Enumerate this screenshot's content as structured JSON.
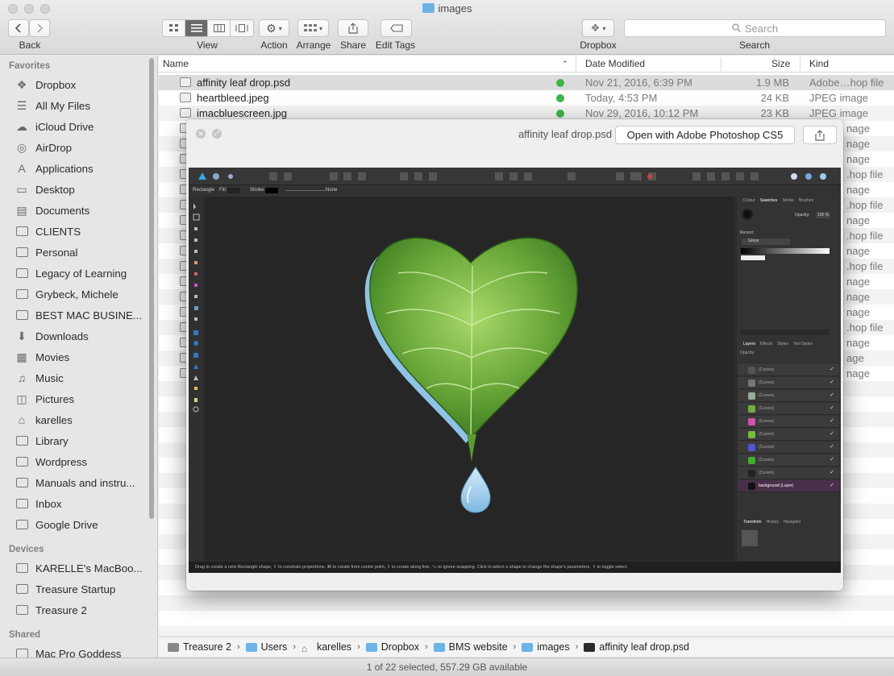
{
  "window": {
    "title": "images",
    "back_label": "Back",
    "view_label": "View",
    "action_label": "Action",
    "arrange_label": "Arrange",
    "share_label": "Share",
    "edit_tags_label": "Edit Tags",
    "dropbox_label": "Dropbox",
    "search_placeholder": "Search",
    "search_label": "Search"
  },
  "sidebar": {
    "favorites_heading": "Favorites",
    "favorites": [
      "Dropbox",
      "All My Files",
      "iCloud Drive",
      "AirDrop",
      "Applications",
      "Desktop",
      "Documents",
      "CLIENTS",
      "Personal",
      "Legacy of Learning",
      "Grybeck, Michele",
      " BEST MAC BUSINE...",
      "Downloads",
      "Movies",
      "Music",
      "Pictures",
      "karelles",
      "Library",
      "Wordpress",
      "Manuals and instru...",
      "Inbox",
      "Google Drive"
    ],
    "devices_heading": "Devices",
    "devices": [
      "KARELLE's MacBoo...",
      "Treasure Startup",
      "Treasure 2"
    ],
    "shared_heading": "Shared",
    "shared": [
      "Mac Pro Goddess"
    ]
  },
  "columns": {
    "name": "Name",
    "date_modified": "Date Modified",
    "size": "Size",
    "kind": "Kind"
  },
  "files": [
    {
      "name": "affinity leaf drop.psd",
      "date": "Nov 21, 2016, 6:39 PM",
      "size": "1.9 MB",
      "kind": "Adobe…hop file"
    },
    {
      "name": "heartbleed.jpeg",
      "date": "Today, 4:53 PM",
      "size": "24 KB",
      "kind": "JPEG image"
    },
    {
      "name": "imacbluescreen.jpg",
      "date": "Nov 29, 2016, 10:12 PM",
      "size": "23 KB",
      "kind": "JPEG image"
    }
  ],
  "hidden_kinds": [
    "nage",
    "nage",
    "nage",
    ".hop file",
    "nage",
    ".hop file",
    "nage",
    ".hop file",
    "nage",
    ".hop file",
    "nage",
    "nage",
    "nage",
    ".hop file",
    "nage",
    "age",
    "nage"
  ],
  "quicklook": {
    "title": "affinity leaf drop.psd",
    "open_with": "Open with Adobe Photoshop CS5"
  },
  "affinity": {
    "context_label": "Rectangle",
    "fill_label": "Fill:",
    "stroke_label": "Stroke:",
    "none_label": "None",
    "tabs": [
      "Colour",
      "Swatches",
      "Stroke",
      "Brushes"
    ],
    "opacity_label": "Opacity:",
    "opacity_value": "100 %",
    "recent_label": "Recent:",
    "greys_label": "Greys",
    "layer_tabs": [
      "Layers",
      "Effects",
      "Styles",
      "Text Styles"
    ],
    "layer_opacity": "Opacity:",
    "layers": [
      "(Curves)",
      "(Curves)",
      "(Curves)",
      "(Curves)",
      "(Curves)",
      "(Curves)",
      "(Curves)",
      "(Curves)",
      "(Curves)",
      "background (Layer)"
    ],
    "transform_tabs": [
      "Transform",
      "History",
      "Navigator"
    ],
    "status_hint": "Drag to create a new Rectangle shape, ⇧ to constrain proportions, ⌘ to create from centre point, ⇧ to create along line, ⌥ to ignore snapping. Click to select a shape to change the shape's parameters, ⇧ to toggle select."
  },
  "pathbar": [
    "Treasure 2",
    "Users",
    "karelles",
    "Dropbox",
    "BMS website",
    "images",
    "affinity leaf drop.psd"
  ],
  "status": "1 of 22 selected, 557.29 GB available",
  "colors": {
    "accent_folder": "#6cb3e8",
    "sync_ok": "#3bb54a",
    "leaf": "#6aa83a",
    "water": "#8ec3e6"
  }
}
